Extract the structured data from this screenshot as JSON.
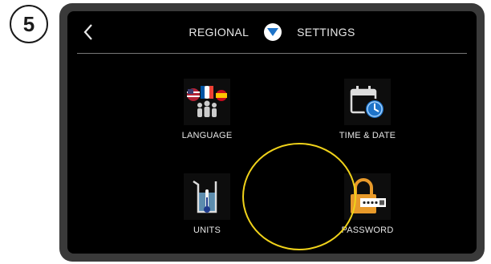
{
  "step": {
    "number": "5"
  },
  "header": {
    "left_title": "REGIONAL",
    "right_title": "SETTINGS",
    "back_icon": "chevron-left-icon",
    "logo_icon": "blue-shield-logo-icon"
  },
  "tiles": [
    {
      "label": "LANGUAGE",
      "icon": "language-flags-icon"
    },
    {
      "label": "TIME & DATE",
      "icon": "calendar-clock-icon"
    },
    {
      "label": "UNITS",
      "icon": "beaker-thermometer-icon"
    },
    {
      "label": "PASSWORD",
      "icon": "padlock-password-icon"
    }
  ],
  "colors": {
    "highlight": "#f0d21a",
    "accent_blue": "#1e73c8",
    "lock_orange": "#e89a2a"
  }
}
